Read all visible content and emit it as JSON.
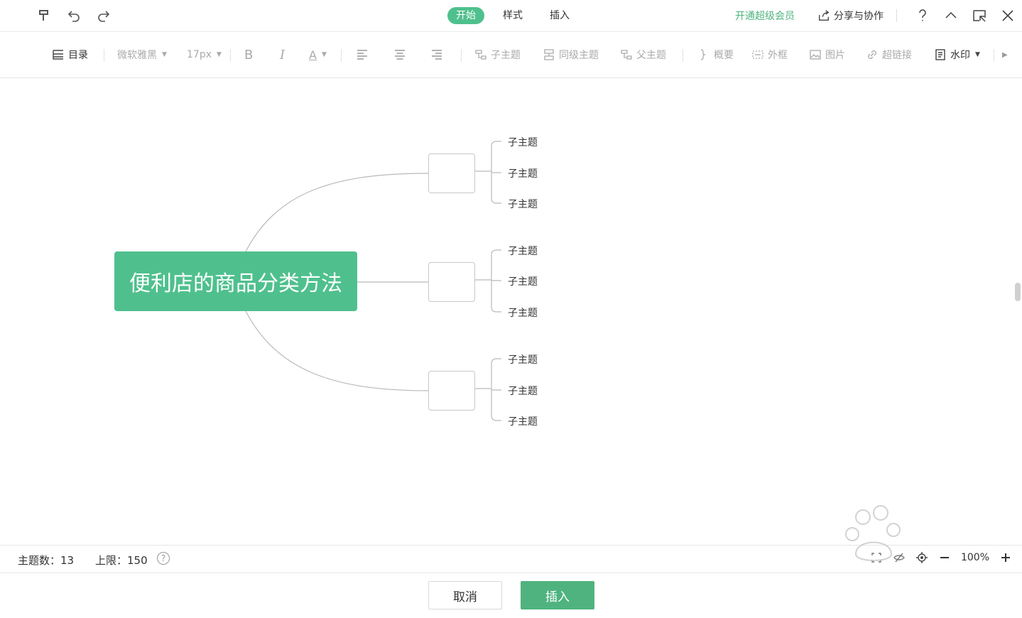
{
  "tabs": [
    {
      "label": "开始",
      "active": true
    },
    {
      "label": "样式",
      "active": false
    },
    {
      "label": "插入",
      "active": false
    }
  ],
  "header": {
    "vip_label": "开通超级会员",
    "share_label": "分享与协作"
  },
  "toolbar": {
    "outline": "目录",
    "font_family": "微软雅黑",
    "font_size": "17px",
    "bold": "B",
    "italic": "I",
    "font_color": "A",
    "child_topic": "子主题",
    "sibling_topic": "同级主题",
    "parent_topic": "父主题",
    "summary": "概要",
    "frame": "外框",
    "image": "图片",
    "hyperlink": "超链接",
    "watermark": "水印"
  },
  "mindmap": {
    "root": "便利店的商品分类方法",
    "branches": [
      {
        "label": "",
        "children": [
          "子主题",
          "子主题",
          "子主题"
        ]
      },
      {
        "label": "",
        "children": [
          "子主题",
          "子主题",
          "子主题"
        ]
      },
      {
        "label": "",
        "children": [
          "子主题",
          "子主题",
          "子主题"
        ]
      }
    ]
  },
  "status": {
    "topic_count_label": "主题数：13",
    "limit_label": "上限：150",
    "help": "?",
    "zoom": "100%"
  },
  "footer": {
    "cancel": "取消",
    "insert": "插入"
  },
  "colors": {
    "accent": "#4fc08d",
    "vip": "#4fb37f",
    "line": "#bbbbbb"
  }
}
